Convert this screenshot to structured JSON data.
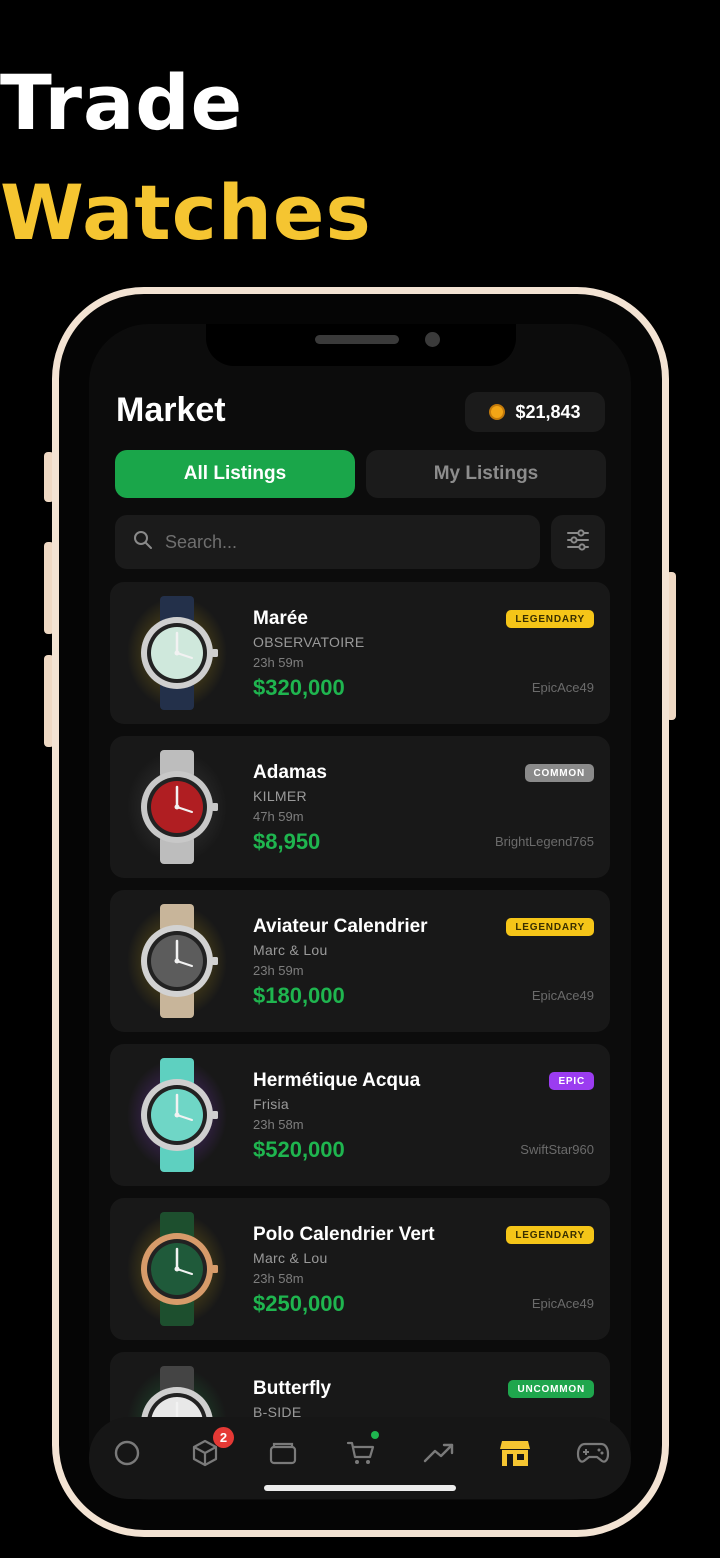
{
  "hero": {
    "line1": "Trade",
    "line2": "Watches"
  },
  "header": {
    "title": "Market",
    "balance": "$21,843"
  },
  "tabs": {
    "all": "All Listings",
    "mine": "My Listings"
  },
  "search": {
    "placeholder": "Search..."
  },
  "listings": [
    {
      "name": "Marée",
      "brand": "OBSERVATOIRE",
      "time": "23h 59m",
      "price": "$320,000",
      "seller": "EpicAce49",
      "rarity": "LEGENDARY",
      "rarity_color": "#f5c518",
      "rarity_text_color": "#3a2f00",
      "dial_color": "#cfe8dc",
      "case_color": "#cfcfcf",
      "strap_color": "#23304a",
      "glow": "#b99a18"
    },
    {
      "name": "Adamas",
      "brand": "KILMER",
      "time": "47h 59m",
      "price": "$8,950",
      "seller": "BrightLegend765",
      "rarity": "COMMON",
      "rarity_color": "#8a8a8a",
      "rarity_text_color": "#ffffff",
      "dial_color": "#b01e22",
      "case_color": "#c8c8c8",
      "strap_color": "#bdbdbd",
      "glow": "#555555"
    },
    {
      "name": "Aviateur Calendrier",
      "brand": "Marc & Lou",
      "time": "23h 59m",
      "price": "$180,000",
      "seller": "EpicAce49",
      "rarity": "LEGENDARY",
      "rarity_color": "#f5c518",
      "rarity_text_color": "#3a2f00",
      "dial_color": "#5c5c5c",
      "case_color": "#d2d2d2",
      "strap_color": "#c8b59a",
      "glow": "#b99a18"
    },
    {
      "name": "Hermétique Acqua",
      "brand": "Frisia",
      "time": "23h 58m",
      "price": "$520,000",
      "seller": "SwiftStar960",
      "rarity": "EPIC",
      "rarity_color": "#9b3cf0",
      "rarity_text_color": "#ffffff",
      "dial_color": "#6fd6c6",
      "case_color": "#cfcfcf",
      "strap_color": "#5ed0c0",
      "glow": "#8a3fd6"
    },
    {
      "name": "Polo Calendrier Vert",
      "brand": "Marc & Lou",
      "time": "23h 58m",
      "price": "$250,000",
      "seller": "EpicAce49",
      "rarity": "LEGENDARY",
      "rarity_color": "#f5c518",
      "rarity_text_color": "#3a2f00",
      "dial_color": "#1f5a3a",
      "case_color": "#d79b6a",
      "strap_color": "#1d4f2e",
      "glow": "#b99a18"
    },
    {
      "name": "Butterfly",
      "brand": "B-SIDE",
      "time": "",
      "price": "",
      "seller": "",
      "rarity": "UNCOMMON",
      "rarity_color": "#1fa64d",
      "rarity_text_color": "#ffffff",
      "dial_color": "#e8e8e8",
      "case_color": "#cfcfcf",
      "strap_color": "#444444",
      "glow": "#2a8a4a"
    }
  ],
  "nav": {
    "badge_count": "2",
    "active": "market",
    "active_color": "#f5c531"
  }
}
